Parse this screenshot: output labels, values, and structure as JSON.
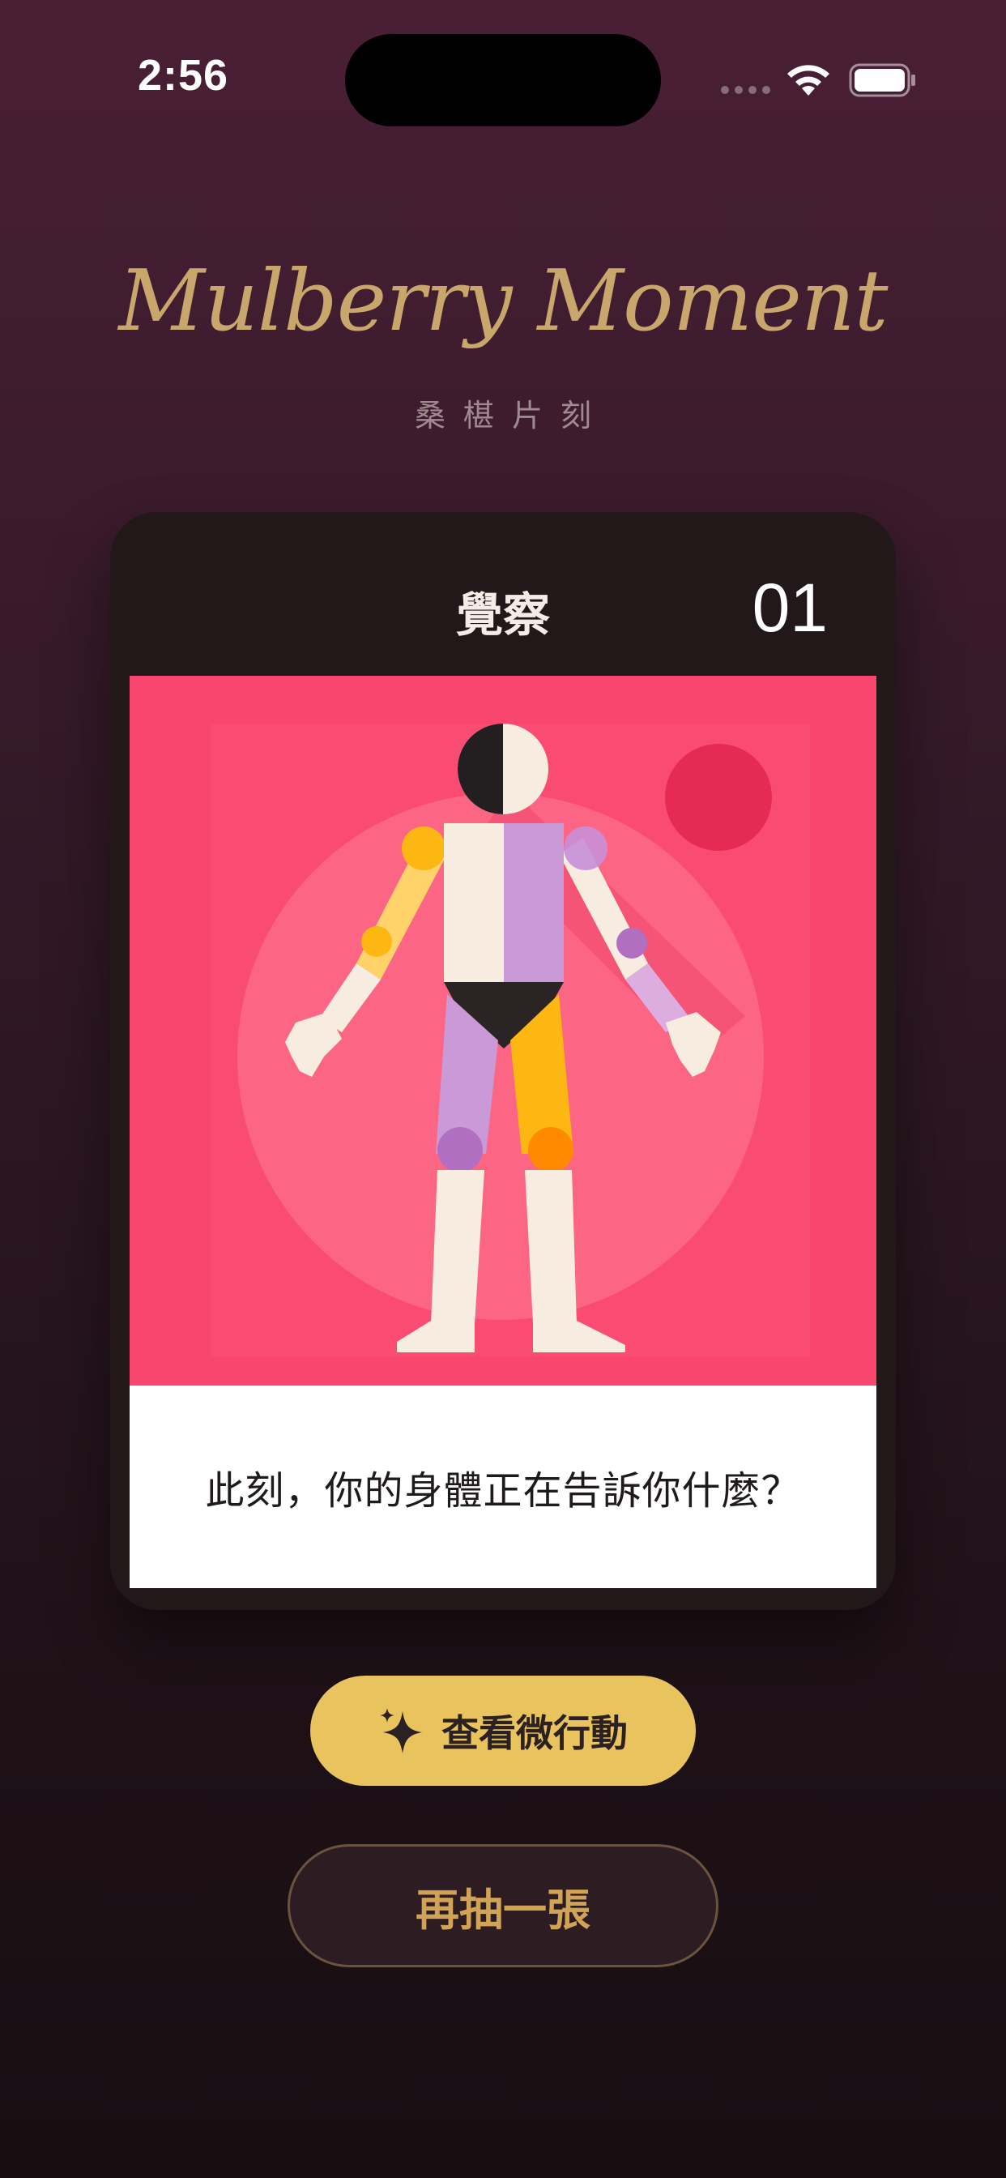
{
  "status_bar": {
    "time": "2:56",
    "icons": [
      "signal-dots-icon",
      "wifi-icon",
      "battery-icon"
    ]
  },
  "header": {
    "title": "Mulberry Moment",
    "subtitle": "桑椹片刻"
  },
  "card": {
    "category": "覺察",
    "number": "01",
    "illustration": "body-figure-illustration",
    "question": "此刻，你的身體正在告訴你什麼？"
  },
  "actions": {
    "primary_label": "查看微行動",
    "primary_icon": "sparkle-icon",
    "secondary_label": "再抽一張"
  },
  "colors": {
    "accent_gold": "#e8c35e",
    "title_gold": "#c9a66b",
    "card_bg": "#221719",
    "illustration_bg": "#f9466e"
  }
}
